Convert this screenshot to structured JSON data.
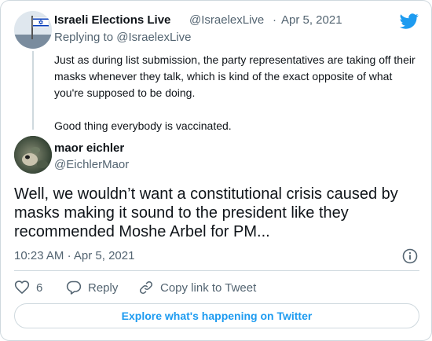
{
  "parent_tweet": {
    "display_name": "Israeli Elections Live",
    "handle": "@IsraelexLive",
    "separator": "·",
    "date": "Apr 5, 2021",
    "replying_label": "Replying to",
    "replying_handle": "@IsraelexLive",
    "text": "Just as during list submission, the party representatives are taking off their masks whenever they talk, which is kind of the exact opposite of what you're supposed to be doing.\n\nGood thing everybody is vaccinated."
  },
  "main_tweet": {
    "display_name": "maor eichler",
    "handle": "@EichlerMaor",
    "text": "Well, we wouldn’t want a constitutional crisis caused by masks making it sound to the president like they recommended Moshe Arbel for PM...",
    "time": "10:23 AM",
    "separator": "·",
    "date": "Apr 5, 2021"
  },
  "actions": {
    "like_count": "6",
    "reply_label": "Reply",
    "copy_link_label": "Copy link to Tweet"
  },
  "explore_label": "Explore what's happening on Twitter",
  "colors": {
    "accent": "#1d9bf0",
    "secondary_text": "#536471",
    "border": "#cfd9de",
    "primary_text": "#0f1419"
  },
  "icons": {
    "brand": "twitter-bird-icon",
    "info": "info-icon",
    "like": "heart-icon",
    "reply": "reply-bubble-icon",
    "copy": "link-icon"
  }
}
